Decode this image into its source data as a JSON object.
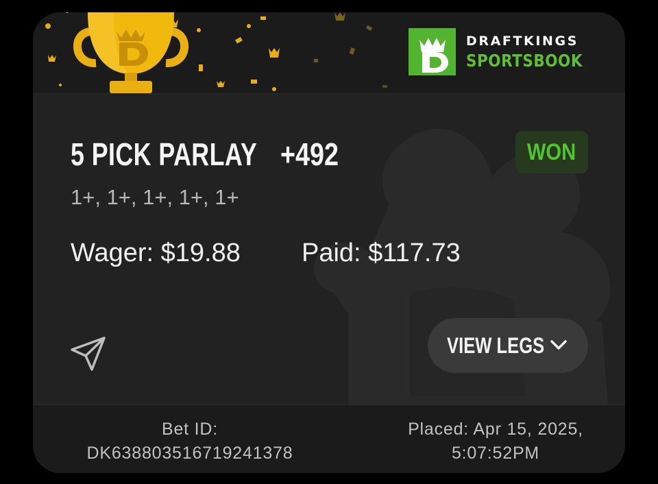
{
  "brand": {
    "line1": "DRAFTKINGS",
    "line2": "SPORTSBOOK",
    "logo_icon": "draftkings-crown-d-logo",
    "green": "#53b430"
  },
  "bet": {
    "title": "5 PICK PARLAY",
    "odds": "+492",
    "status": "WON",
    "legs_summary": "1+, 1+, 1+, 1+, 1+",
    "wager": "Wager: $19.88",
    "paid": "Paid: $117.73"
  },
  "actions": {
    "share_icon": "paper-plane-share-icon",
    "view_legs_label": "VIEW LEGS",
    "view_legs_icon": "chevron-down-icon"
  },
  "footer": {
    "bet_id_label": "Bet ID:",
    "bet_id": "DK638803516719241378",
    "placed_line1": "Placed: Apr 15, 2025,",
    "placed_line2": "5:07:52PM"
  },
  "decor": {
    "trophy_icon": "gold-trophy-icon",
    "gold": "#f2b70c",
    "won_green": "#4fc62e"
  }
}
